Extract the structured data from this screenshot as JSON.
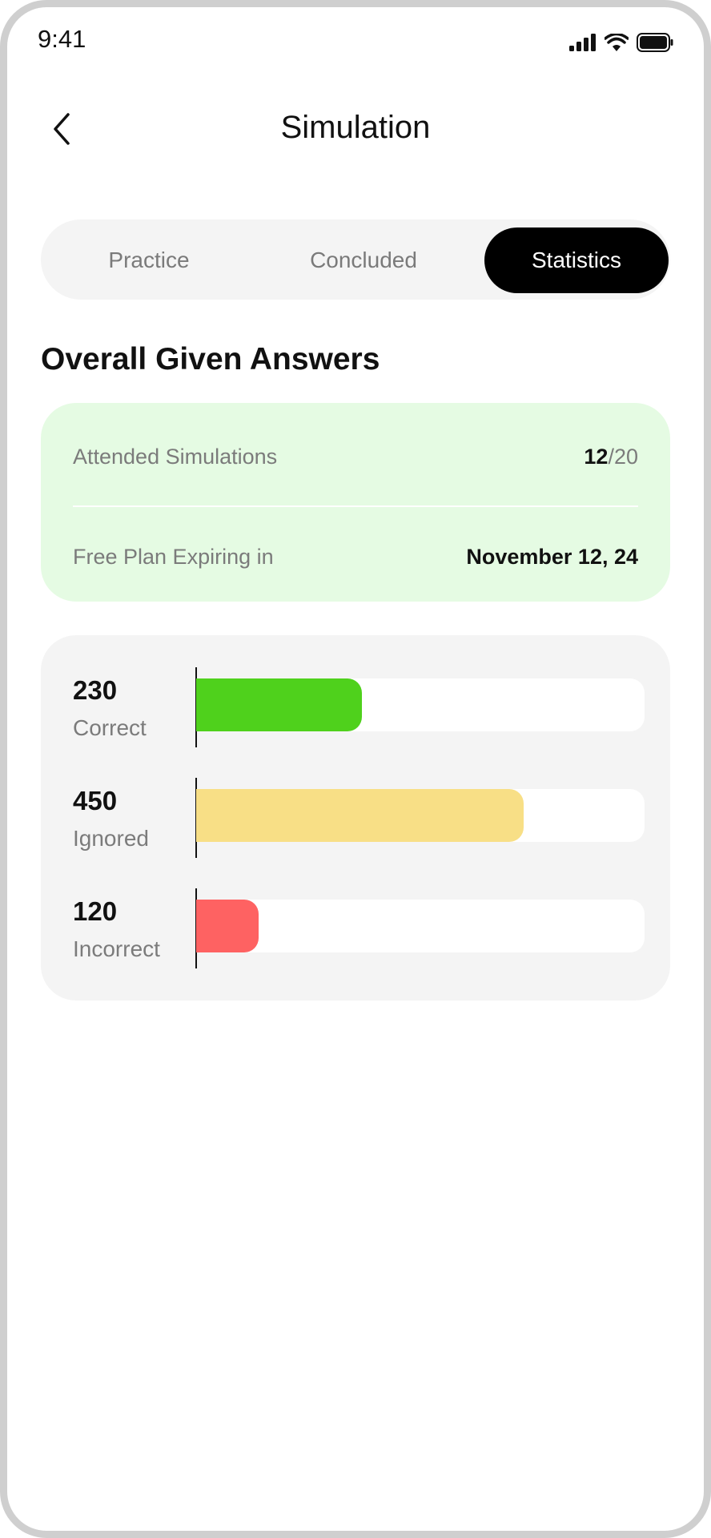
{
  "status_bar": {
    "time": "9:41"
  },
  "nav": {
    "title": "Simulation"
  },
  "tabs": [
    {
      "label": "Practice",
      "active": false
    },
    {
      "label": "Concluded",
      "active": false
    },
    {
      "label": "Statistics",
      "active": true
    }
  ],
  "section_title": "Overall Given Answers",
  "info": {
    "attended_label": "Attended Simulations",
    "attended_count": "12",
    "attended_total": "/20",
    "plan_label": "Free Plan Expiring in",
    "plan_date": "November 12, 24"
  },
  "stats": [
    {
      "value": "230",
      "label": "Correct",
      "fraction": 0.37,
      "color": "#4fd11c"
    },
    {
      "value": "450",
      "label": "Ignored",
      "fraction": 0.73,
      "color": "#f8df86"
    },
    {
      "value": "120",
      "label": "Incorrect",
      "fraction": 0.14,
      "color": "#fe6262"
    }
  ],
  "colors": {
    "accent_dark": "#000000",
    "info_card_bg": "#e5fbe3",
    "stats_card_bg": "#f4f4f4"
  },
  "icons": [
    "signal-icon",
    "wifi-icon",
    "battery-icon",
    "back-chevron-icon"
  ]
}
